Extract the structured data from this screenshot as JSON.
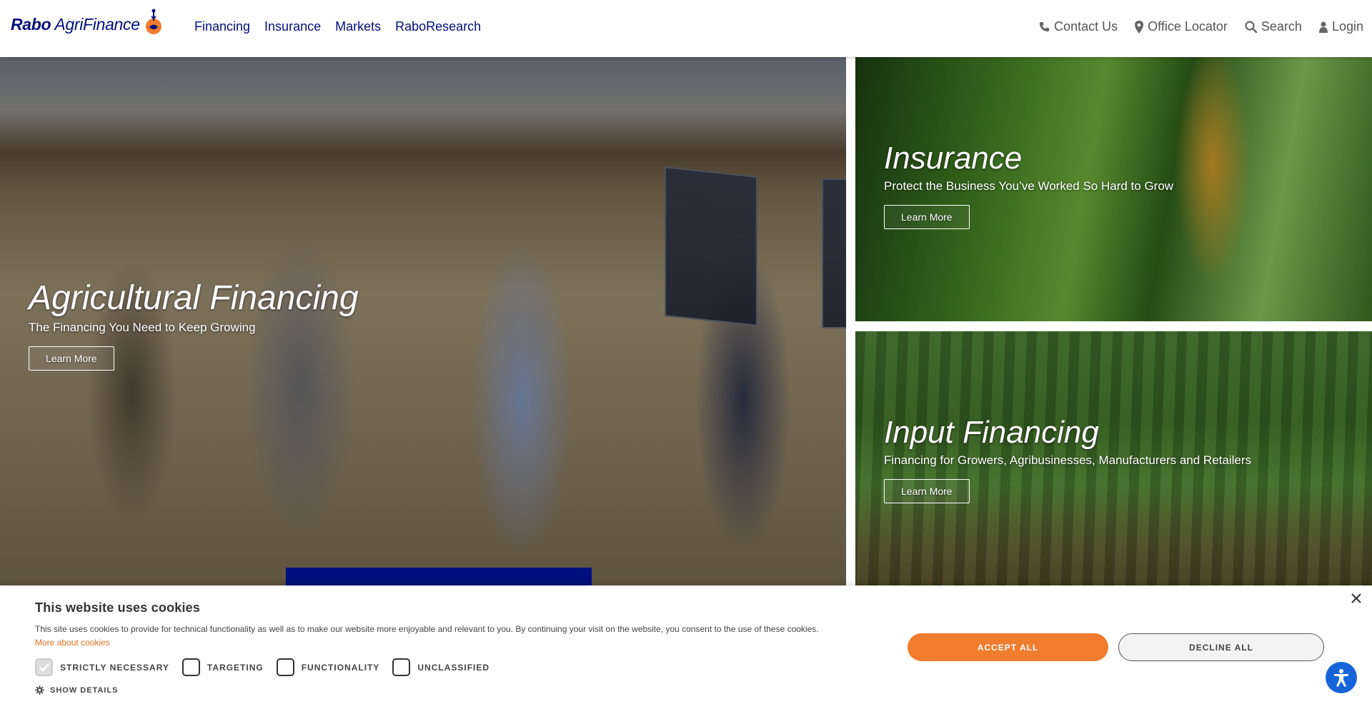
{
  "header": {
    "logo_bold": "Rabo",
    "logo_rest": "AgriFinance",
    "nav": [
      "Financing",
      "Insurance",
      "Markets",
      "RaboResearch"
    ],
    "utility": {
      "contact": "Contact Us",
      "office": "Office Locator",
      "search": "Search",
      "login": "Login"
    }
  },
  "tiles": {
    "main": {
      "title": "Agricultural Financing",
      "subtitle": "The Financing You Need to Keep Growing",
      "button": "Learn More"
    },
    "insurance": {
      "title": "Insurance",
      "subtitle": "Protect the Business You’ve Worked So Hard to Grow",
      "button": "Learn More"
    },
    "input": {
      "title": "Input Financing",
      "subtitle": "Financing for Growers, Agribusinesses, Manufacturers and Retailers",
      "button": "Learn More"
    }
  },
  "cookie": {
    "title": "This website uses cookies",
    "description": "This site uses cookies to provide for technical functionality as well as to make our website more enjoyable and relevant to you. By continuing your visit on the website, you consent to the use of these cookies.",
    "more_link": "More about cookies",
    "options": [
      {
        "label": "STRICTLY NECESSARY",
        "checked": true
      },
      {
        "label": "TARGETING",
        "checked": false
      },
      {
        "label": "FUNCTIONALITY",
        "checked": false
      },
      {
        "label": "UNCLASSIFIED",
        "checked": false
      }
    ],
    "show_details": "SHOW DETAILS",
    "accept": "ACCEPT ALL",
    "decline": "DECLINE ALL"
  },
  "colors": {
    "brand_navy": "#000f7d",
    "accent_orange": "#f07c2e",
    "a11y_blue": "#1565d8"
  }
}
